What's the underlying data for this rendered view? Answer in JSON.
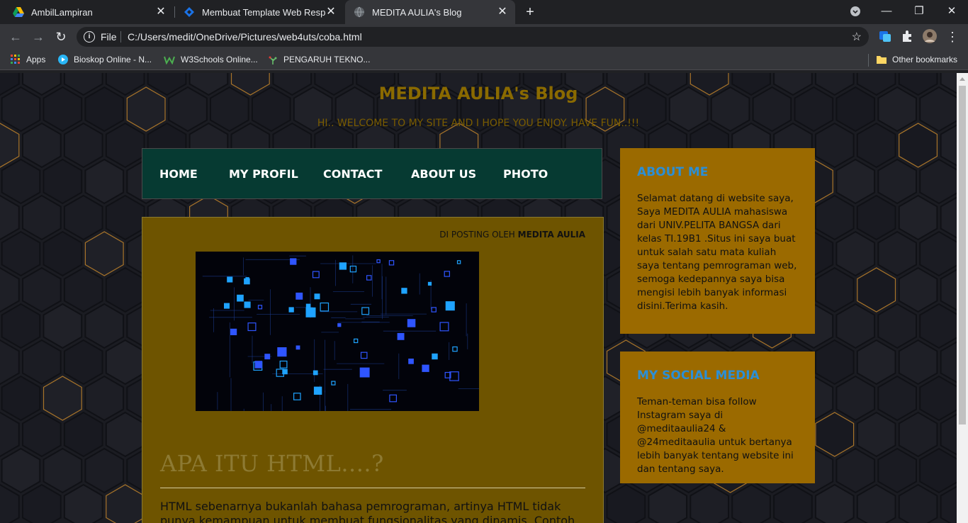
{
  "browser": {
    "tabs": [
      {
        "title": "AmbilLampiran",
        "icon": "google-drive-icon",
        "active": false
      },
      {
        "title": "Membuat Template Web Respon",
        "icon": "codepolitan-icon",
        "active": false
      },
      {
        "title": "MEDITA AULIA's Blog",
        "icon": "globe-icon",
        "active": true
      }
    ],
    "address": {
      "scheme_label": "File",
      "url": "C:/Users/medit/OneDrive/Pictures/web4uts/coba.html"
    },
    "bookmarks": [
      {
        "label": "Apps",
        "icon": "apps-grid-icon"
      },
      {
        "label": "Bioskop Online - N...",
        "icon": "play-icon"
      },
      {
        "label": "W3Schools Online...",
        "icon": "w3schools-icon"
      },
      {
        "label": "PENGARUH TEKNO...",
        "icon": "tree-icon"
      }
    ],
    "other_bookmarks": "Other bookmarks"
  },
  "site": {
    "title": "MEDITA AULIA's Blog",
    "tagline": "HI.. WELCOME TO MY SITE AND I HOPE YOU ENJOY. HAVE FUN..!!!",
    "nav": [
      "HOME",
      "MY PROFIL",
      "CONTACT",
      "ABOUT US",
      "PHOTO"
    ]
  },
  "post": {
    "byline_prefix": "DI POSTING OLEH",
    "author": "MEDITA AULIA",
    "title": "APA ITU HTML....?",
    "body": "HTML sebenarnya bukanlah bahasa pemrograman, artinya HTML tidak punya kemampuan untuk membuat fungsionalitas yang dinamis. Contoh kode atau"
  },
  "sidebar": {
    "about": {
      "heading": "ABOUT ME",
      "text": "Selamat datang di website saya, Saya MEDITA AULIA mahasiswa dari UNIV.PELITA BANGSA dari kelas TI.19B1 .Situs ini saya buat untuk salah satu mata kuliah saya tentang pemrograman web, semoga kedepannya saya bisa mengisi lebih banyak informasi disini.Terima kasih."
    },
    "social": {
      "heading": "MY SOCIAL MEDIA",
      "text": "Teman-teman bisa follow Instagram saya di @meditaaulia24 & @24meditaaulia untuk bertanya lebih banyak tentang website ini dan tentang saya."
    }
  },
  "colors": {
    "nav_bg": "#063a32",
    "post_bg": "#6e5400",
    "widget_bg": "#9b6a00",
    "widget_heading": "#2b8fd6",
    "title_gold": "#8a6a00"
  }
}
